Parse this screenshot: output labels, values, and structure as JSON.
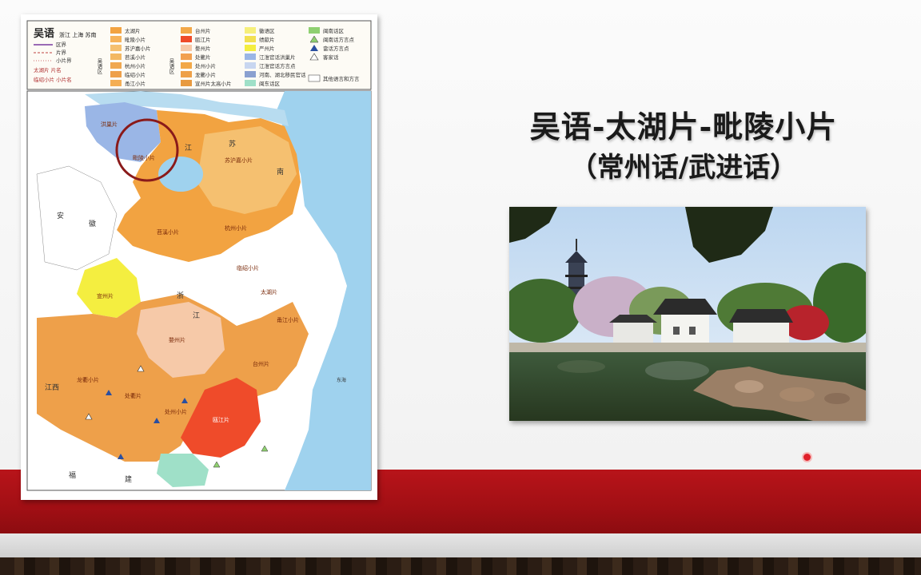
{
  "slide": {
    "title": "吴语-太湖片-毗陵小片",
    "subtitle": "（常州话/武进话）"
  },
  "map": {
    "legend_title": "吴语",
    "legend_region": "浙江 上海 苏南",
    "legend_lines": [
      "区界",
      "片界",
      "小片界",
      "太湖片 片名",
      "临绍小片 小片名"
    ],
    "legend_col1_group": "吴语区",
    "legend_col1": [
      "太湖片",
      "毗陵小片",
      "苏沪嘉小片",
      "苕溪小片",
      "杭州小片",
      "临绍小片",
      "甬江小片"
    ],
    "legend_col2_group": "吴语区",
    "legend_col2": [
      "台州片",
      "瓯江片",
      "婺州片",
      "处衢片",
      "处州小片",
      "龙衢小片",
      "宣州片太高小片"
    ],
    "legend_col3": [
      "徽语区",
      "绩歙片",
      "严州片",
      "江淮官话洪巢片",
      "江淮官话方言点",
      "河南、湖北移民官话",
      "闽东话区"
    ],
    "legend_col4": [
      "闽南话区",
      "闽南话方言点",
      "畲话方言点",
      "客家话",
      "其他语言和方言"
    ],
    "regions": [
      "洪巢片",
      "毗陵小片",
      "苏沪嘉小片",
      "苕溪小片",
      "杭州小片",
      "临绍小片",
      "太湖片",
      "甬江小片",
      "宣州片",
      "婺州片",
      "台州片",
      "处衢片",
      "龙衢小片",
      "处州小片",
      "瓯江片"
    ],
    "places": [
      "江",
      "苏",
      "安",
      "徽",
      "浙",
      "江",
      "福",
      "建",
      "江西",
      "东海",
      "南"
    ]
  },
  "photo": {
    "description_icon": "garden-pavilion-photo"
  },
  "colors": {
    "accent_red": "#a10f14",
    "taihu_orange": "#f2a341",
    "sea_blue": "#9fd2ee"
  }
}
